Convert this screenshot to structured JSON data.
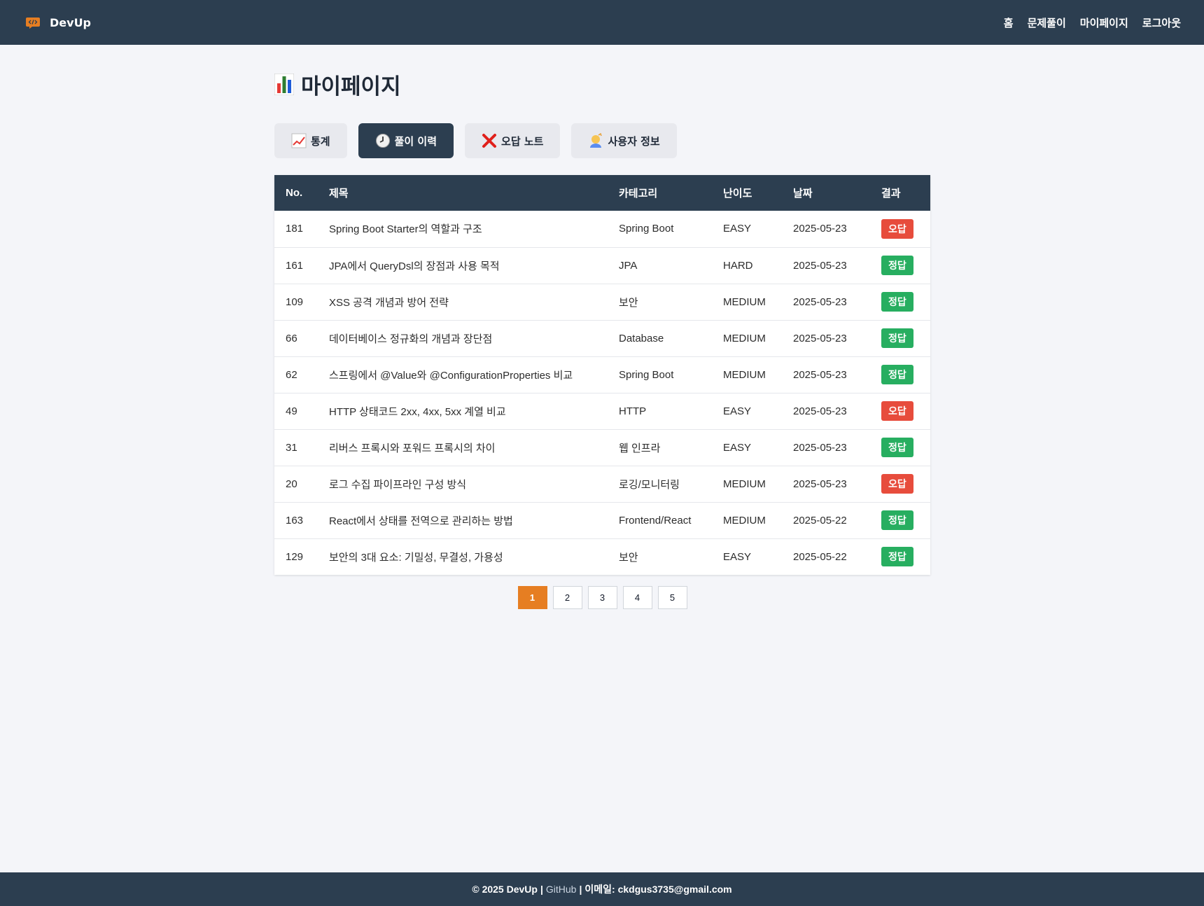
{
  "nav": {
    "brand": "DevUp",
    "links": [
      "홈",
      "문제풀이",
      "마이페이지",
      "로그아웃"
    ]
  },
  "page": {
    "title": "마이페이지",
    "title_icon": "bar-chart-icon"
  },
  "tabs": [
    {
      "label": "통계",
      "icon": "trending-up-icon",
      "active": false
    },
    {
      "label": "풀이 이력",
      "icon": "clock-icon",
      "active": true
    },
    {
      "label": "오답 노트",
      "icon": "x-mark-icon",
      "active": false
    },
    {
      "label": "사용자 정보",
      "icon": "user-icon",
      "active": false
    }
  ],
  "table": {
    "headers": [
      "No.",
      "제목",
      "카테고리",
      "난이도",
      "날짜",
      "결과"
    ],
    "rows": [
      {
        "no": "181",
        "title": "Spring Boot Starter의 역할과 구조",
        "category": "Spring Boot",
        "difficulty": "EASY",
        "date": "2025-05-23",
        "result": "오답"
      },
      {
        "no": "161",
        "title": "JPA에서 QueryDsl의 장점과 사용 목적",
        "category": "JPA",
        "difficulty": "HARD",
        "date": "2025-05-23",
        "result": "정답"
      },
      {
        "no": "109",
        "title": "XSS 공격 개념과 방어 전략",
        "category": "보안",
        "difficulty": "MEDIUM",
        "date": "2025-05-23",
        "result": "정답"
      },
      {
        "no": "66",
        "title": "데이터베이스 정규화의 개념과 장단점",
        "category": "Database",
        "difficulty": "MEDIUM",
        "date": "2025-05-23",
        "result": "정답"
      },
      {
        "no": "62",
        "title": "스프링에서 @Value와 @ConfigurationProperties 비교",
        "category": "Spring Boot",
        "difficulty": "MEDIUM",
        "date": "2025-05-23",
        "result": "정답"
      },
      {
        "no": "49",
        "title": "HTTP 상태코드 2xx, 4xx, 5xx 계열 비교",
        "category": "HTTP",
        "difficulty": "EASY",
        "date": "2025-05-23",
        "result": "오답"
      },
      {
        "no": "31",
        "title": "리버스 프록시와 포워드 프록시의 차이",
        "category": "웹 인프라",
        "difficulty": "EASY",
        "date": "2025-05-23",
        "result": "정답"
      },
      {
        "no": "20",
        "title": "로그 수집 파이프라인 구성 방식",
        "category": "로깅/모니터링",
        "difficulty": "MEDIUM",
        "date": "2025-05-23",
        "result": "오답"
      },
      {
        "no": "163",
        "title": "React에서 상태를 전역으로 관리하는 방법",
        "category": "Frontend/React",
        "difficulty": "MEDIUM",
        "date": "2025-05-22",
        "result": "정답"
      },
      {
        "no": "129",
        "title": "보안의 3대 요소: 기밀성, 무결성, 가용성",
        "category": "보안",
        "difficulty": "EASY",
        "date": "2025-05-22",
        "result": "정답"
      }
    ]
  },
  "pagination": {
    "pages": [
      "1",
      "2",
      "3",
      "4",
      "5"
    ],
    "current": "1"
  },
  "footer": {
    "copyright": "© 2025 DevUp",
    "sep1": "|",
    "github": "GitHub",
    "sep2": "|",
    "email": "이메일: ckdgus3735@gmail.com"
  },
  "colors": {
    "navbar": "#2c3e50",
    "background": "#f4f5f9",
    "accent": "#e67e22",
    "wrong": "#e74c3c",
    "right": "#27ae60"
  }
}
